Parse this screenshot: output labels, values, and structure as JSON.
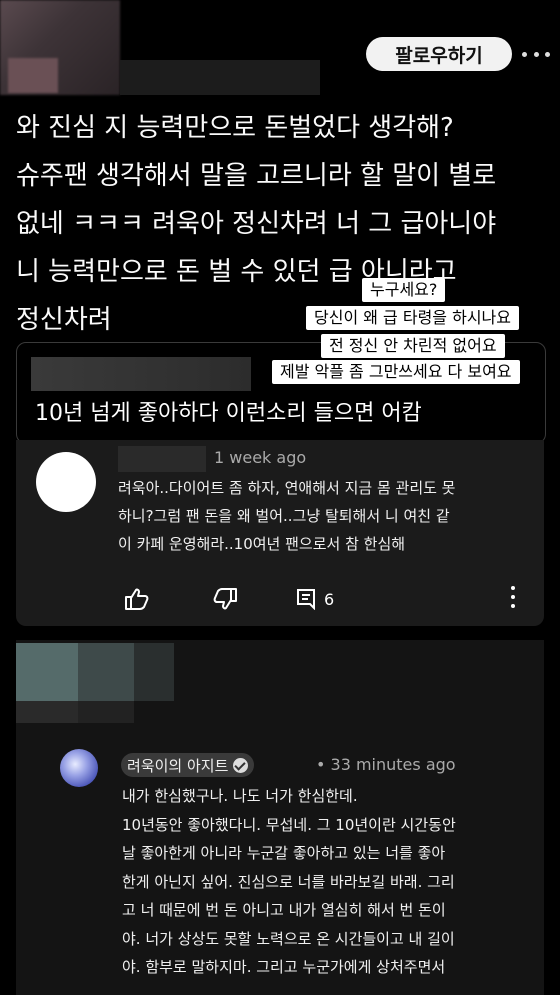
{
  "header": {
    "follow_label": "팔로우하기"
  },
  "post": {
    "text": "와 진심 지 능력만으로 돈벌었다 생각해?\n슈주팬 생각해서 말을 고르니라 할 말이 별로\n없네 ㅋㅋㅋ 려욱아 정신차려 너 그 급아니야\n니 능력만으로 돈 벌 수 있던 급 아니라고\n정신차려"
  },
  "captions": [
    "누구세요?",
    "당신이 왜 급 타령을 하시나요",
    "전 정신 안 차린적 없어요",
    "제발 악플 좀 그만쓰세요 다 보여요"
  ],
  "quote": {
    "text": "10년 넘게 좋아하다 이런소리 들으면 어캄"
  },
  "comment": {
    "time": "1 week ago",
    "text": "려욱아..다이어트 좀 하자, 연애해서 지금 몸 관리도 못\n하니?그럼 팬 돈을 왜 벌어..그냥 탈퇴해서 니 여친 같\n이 카페 운영해라..10여년 팬으로서 참 한심해",
    "reply_count": "6"
  },
  "reply": {
    "author": "려욱이의 아지트",
    "time": "• 33 minutes ago",
    "text": "내가 한심했구나. 나도 너가 한심한데.\n10년동안 좋아했다니. 무섭네. 그 10년이란 시간동안\n날 좋아한게 아니라 누군갈 좋아하고 있는 너를 좋아\n한게 아닌지 싶어. 진심으로 너를 바라보길 바래. 그리\n고 너 때문에 번 돈 아니고 내가 열심히 해서 번 돈이\n야. 너가 상상도 못할 노력으로 온 시간들이고 내 길이\n야. 함부로 말하지마. 그리고 누군가에게 상처주면서"
  },
  "icons": [
    "more-horizontal-icon",
    "thumbs-up-icon",
    "thumbs-down-icon",
    "reply-icon",
    "more-vertical-icon",
    "verified-check-icon"
  ]
}
